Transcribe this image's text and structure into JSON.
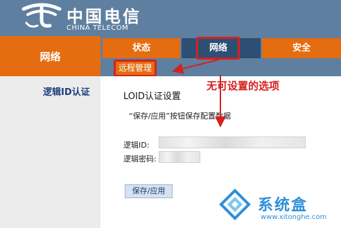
{
  "header": {
    "logo_cn": "中国电信",
    "logo_en": "CHINA TELECOM"
  },
  "sidebar": {
    "title": "网络",
    "items": [
      {
        "label": "逻辑ID认证"
      }
    ]
  },
  "tabs": [
    {
      "label": "状态"
    },
    {
      "label": "网络",
      "selected": true
    },
    {
      "label": "安全"
    }
  ],
  "subtabs": [
    {
      "label": "远程管理"
    }
  ],
  "main": {
    "section_title": "LOID认证设置",
    "hint": "“保存/应用”按钮保存配置数据",
    "fields": [
      {
        "label": "逻辑ID:",
        "value": ""
      },
      {
        "label": "逻辑密码:",
        "value": ""
      }
    ],
    "save_label": "保存/应用"
  },
  "annotation": {
    "text": "无可设置的选项"
  },
  "watermark": {
    "text": "系统盒",
    "url": "www.xitonghe.com"
  },
  "colors": {
    "header_blue": "#5e7f9f",
    "orange": "#e46d12",
    "dark_blue": "#2d4f74",
    "highlight_red": "#d62020",
    "watermark_blue": "#2f8fd6"
  },
  "icons": {
    "logo": "china-telecom-logo-icon",
    "watermark": "xitonghe-logo-icon"
  }
}
